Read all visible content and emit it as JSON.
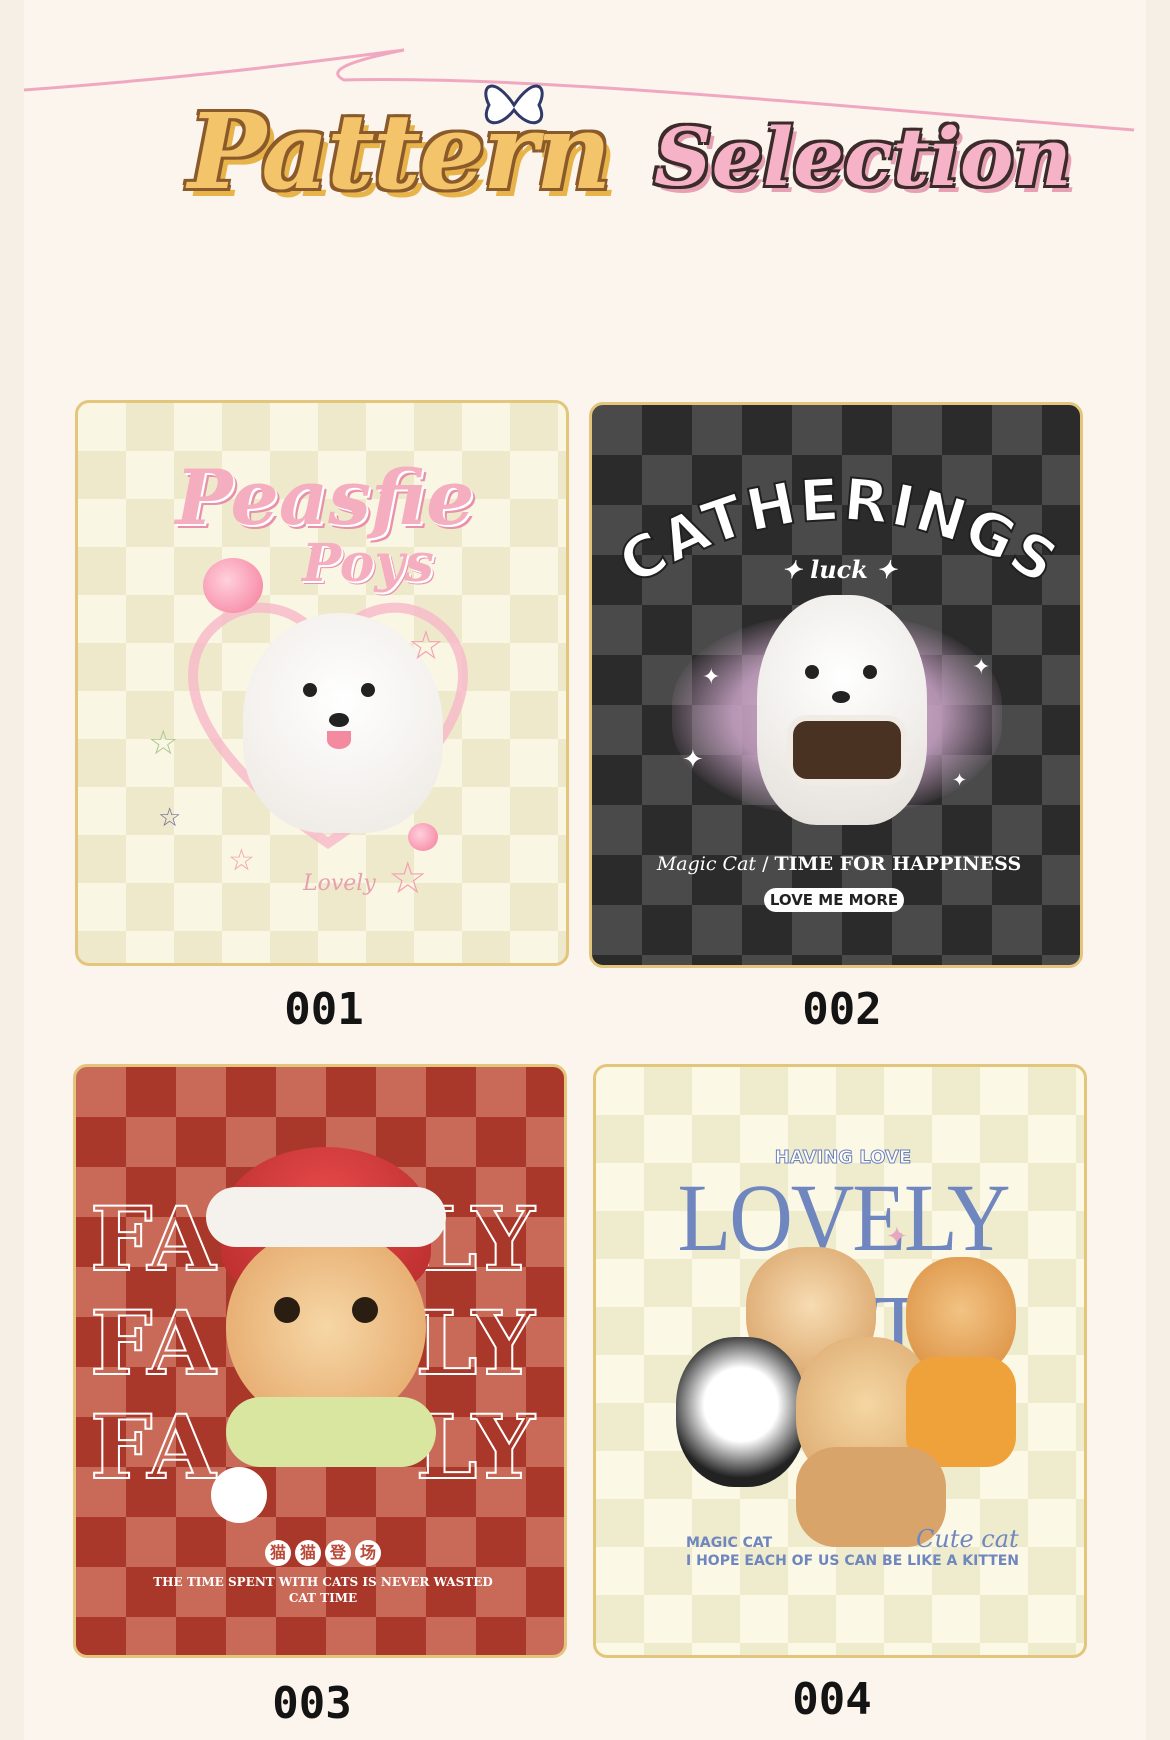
{
  "header": {
    "title_part1": "Pattern",
    "title_part2": "Selection"
  },
  "colors": {
    "background": "#fbf5ee",
    "card_border": "#e3c57c",
    "title_gold": "#f3c46a",
    "title_pink": "#f6b3c8"
  },
  "patterns": [
    {
      "label": "001",
      "title_line1": "Peasfie",
      "title_line2": "Poys",
      "script_text": "Lovely"
    },
    {
      "label": "002",
      "title": "CATHERINGS",
      "sub": "luck",
      "caption": "Magic Cat",
      "caption2": "TIME FOR HAPPINESS",
      "tag": "LOVE ME MORE"
    },
    {
      "label": "003",
      "word1": "FA",
      "word2": "LY",
      "chinese": [
        "猫",
        "猫",
        "登",
        "场"
      ],
      "caption1": "THE TIME SPENT WITH CATS IS NEVER WASTED",
      "caption2": "CAT TIME"
    },
    {
      "label": "004",
      "top": "HAVING LOVE",
      "title": "LOVELY CAT",
      "caption1": "MAGIC CAT",
      "script_text": "Cute cat",
      "caption2": "I HOPE EACH OF US CAN BE LIKE A KITTEN"
    }
  ]
}
